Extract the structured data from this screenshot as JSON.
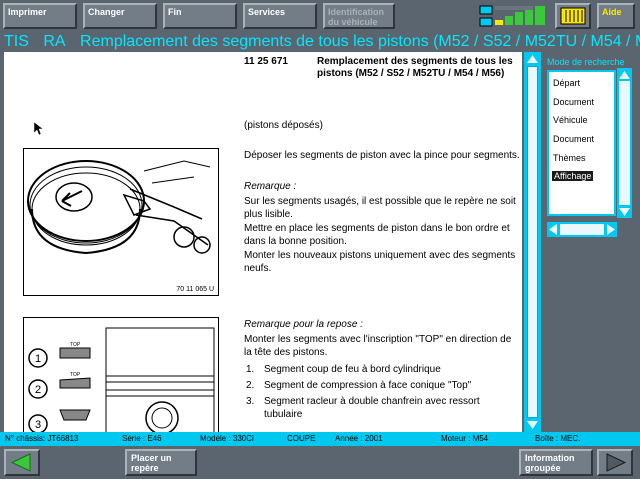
{
  "toolbar": {
    "print_label": "Imprimer",
    "change_label": "Changer",
    "end_label": "Fin",
    "services_label": "Services",
    "vehicle_id_label": "Identification du véhicule",
    "help_label": "Aide"
  },
  "title": {
    "app": "TIS",
    "mode": "RA",
    "text": "Remplacement des segments de tous les pistons (M52 / S52 / M52TU / M54 / M56)"
  },
  "document": {
    "ref_number": "11 25 671",
    "ref_title": "Remplacement des segments de tous les pistons (M52 / S52 / M52TU / M54 / M56)",
    "precondition": "(pistons déposés)",
    "step1": "Déposer les segments de piston avec la pince pour segments.",
    "remark_label": "Remarque :",
    "remark1": "Sur les segments usagés, il est possible que le repère ne soit plus lisible.",
    "remark2": "Mettre en place les segments de piston dans le bon ordre et dans la bonne position.",
    "remark3": "Monter les nouveaux pistons uniquement avec des segments neufs.",
    "fig1_number": "70 11 065 U",
    "remark_install_label": "Remarque pour la repose :",
    "install_text": "Monter les segments avec l'inscription \"TOP\" en direction de la tête des pistons.",
    "list": [
      {
        "num": "1.",
        "text": "Segment coup de feu à bord cylindrique"
      },
      {
        "num": "2.",
        "text": "Segment de compression à face conique \"Top\""
      },
      {
        "num": "3.",
        "text": "Segment racleur à double chanfrein avec ressort tubulaire"
      }
    ],
    "fig2_callouts": [
      "1",
      "2",
      "3"
    ],
    "fig2_top_label": "TOP"
  },
  "panel": {
    "label": "Mode de recherche",
    "items": [
      {
        "label": "Départ",
        "selected": false
      },
      {
        "label": "Document",
        "selected": false
      },
      {
        "label": "Véhicule",
        "selected": false
      },
      {
        "label": "Document",
        "selected": false
      },
      {
        "label": "Thèmes",
        "selected": false
      },
      {
        "label": "Affichage",
        "selected": true
      }
    ]
  },
  "infobar": {
    "chassis": "N° châssis: JT66813",
    "series": "Série : E46",
    "model": "Modèle : 330Ci",
    "body": "COUPE",
    "year": "Année : 2001",
    "engine": "Moteur : M54",
    "gearbox": "Boîte : MEC."
  },
  "bottom": {
    "place_marker_label": "Placer un repère",
    "grouped_info_label": "Information groupée"
  },
  "colors": {
    "accent": "#00c8ee",
    "title_text": "#00e8ff",
    "background": "#5b6570",
    "nav_green": "#39c93a"
  }
}
